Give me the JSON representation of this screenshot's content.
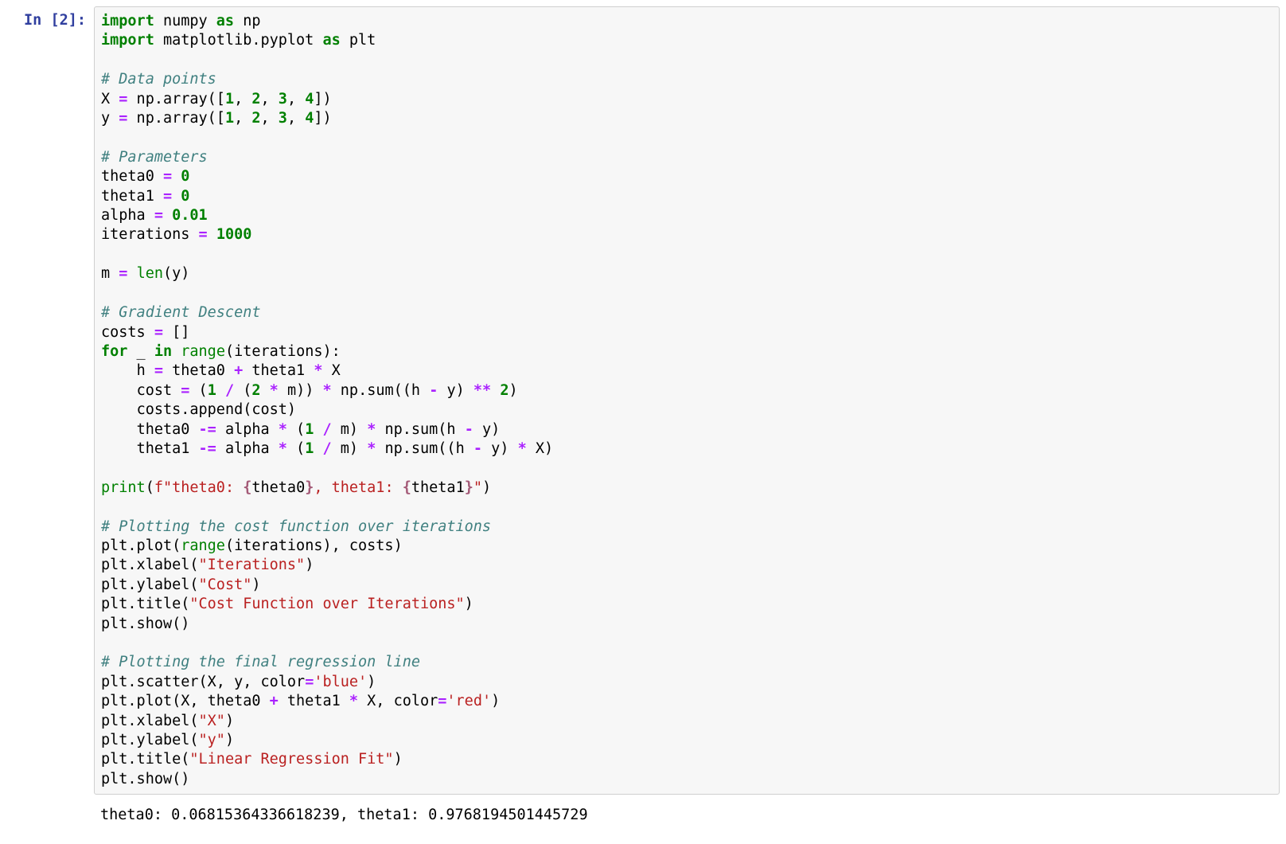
{
  "prompt": "In [2]:",
  "code": {
    "l1": {
      "kw1": "import",
      "sp": " ",
      "n1": "numpy ",
      "kw2": "as",
      "n2": " np"
    },
    "l2": {
      "kw1": "import",
      "n1": " matplotlib.pyplot ",
      "kw2": "as",
      "n2": " plt"
    },
    "l4": {
      "cm": "# Data points"
    },
    "l5": {
      "a": "X ",
      "op1": "=",
      "b": " np.array([",
      "n1": "1",
      "c1": ", ",
      "n2": "2",
      "c2": ", ",
      "n3": "3",
      "c3": ", ",
      "n4": "4",
      "d": "])"
    },
    "l6": {
      "a": "y ",
      "op1": "=",
      "b": " np.array([",
      "n1": "1",
      "c1": ", ",
      "n2": "2",
      "c2": ", ",
      "n3": "3",
      "c3": ", ",
      "n4": "4",
      "d": "])"
    },
    "l8": {
      "cm": "# Parameters"
    },
    "l9": {
      "a": "theta0 ",
      "op": "=",
      "sp": " ",
      "n": "0"
    },
    "l10": {
      "a": "theta1 ",
      "op": "=",
      "sp": " ",
      "n": "0"
    },
    "l11": {
      "a": "alpha ",
      "op": "=",
      "sp": " ",
      "n": "0.01"
    },
    "l12": {
      "a": "iterations ",
      "op": "=",
      "sp": " ",
      "n": "1000"
    },
    "l14": {
      "a": "m ",
      "op": "=",
      "sp": " ",
      "bi": "len",
      "b": "(y)"
    },
    "l16": {
      "cm": "# Gradient Descent"
    },
    "l17": {
      "a": "costs ",
      "op": "=",
      "b": " []"
    },
    "l18": {
      "kw1": "for",
      "a": " _ ",
      "kw2": "in",
      "sp": " ",
      "bi": "range",
      "b": "(iterations):"
    },
    "l19": {
      "ind": "    ",
      "a": "h ",
      "op1": "=",
      "b": " theta0 ",
      "op2": "+",
      "c": " theta1 ",
      "op3": "*",
      "d": " X"
    },
    "l20": {
      "ind": "    ",
      "a": "cost ",
      "op1": "=",
      "b": " (",
      "n1": "1",
      "c": " ",
      "op2": "/",
      "d": " (",
      "n2": "2",
      "e": " ",
      "op3": "*",
      "f": " m)) ",
      "op4": "*",
      "g": " np.sum((h ",
      "op5": "-",
      "h": " y) ",
      "op6": "**",
      "sp": " ",
      "n3": "2",
      "i": ")"
    },
    "l21": {
      "ind": "    ",
      "a": "costs.append(cost)"
    },
    "l22": {
      "ind": "    ",
      "a": "theta0 ",
      "op1": "-=",
      "b": " alpha ",
      "op2": "*",
      "c": " (",
      "n1": "1",
      "d": " ",
      "op3": "/",
      "e": " m) ",
      "op4": "*",
      "f": " np.sum(h ",
      "op5": "-",
      "g": " y)"
    },
    "l23": {
      "ind": "    ",
      "a": "theta1 ",
      "op1": "-=",
      "b": " alpha ",
      "op2": "*",
      "c": " (",
      "n1": "1",
      "d": " ",
      "op3": "/",
      "e": " m) ",
      "op4": "*",
      "f": " np.sum((h ",
      "op5": "-",
      "g": " y) ",
      "op6": "*",
      "h": " X)"
    },
    "l25": {
      "bi": "print",
      "a": "(",
      "s1": "f\"theta0: ",
      "si1": "{",
      "v1": "theta0",
      "si2": "}",
      "s2": ", theta1: ",
      "si3": "{",
      "v2": "theta1",
      "si4": "}",
      "s3": "\"",
      "b": ")"
    },
    "l27": {
      "cm": "# Plotting the cost function over iterations"
    },
    "l28": {
      "a": "plt.plot(",
      "bi": "range",
      "b": "(iterations), costs)"
    },
    "l29": {
      "a": "plt.xlabel(",
      "s": "\"Iterations\"",
      "b": ")"
    },
    "l30": {
      "a": "plt.ylabel(",
      "s": "\"Cost\"",
      "b": ")"
    },
    "l31": {
      "a": "plt.title(",
      "s": "\"Cost Function over Iterations\"",
      "b": ")"
    },
    "l32": {
      "a": "plt.show()"
    },
    "l34": {
      "cm": "# Plotting the final regression line"
    },
    "l35": {
      "a": "plt.scatter(X, y, color",
      "op": "=",
      "s": "'blue'",
      "b": ")"
    },
    "l36": {
      "a": "plt.plot(X, theta0 ",
      "op1": "+",
      "b": " theta1 ",
      "op2": "*",
      "c": " X, color",
      "op3": "=",
      "s": "'red'",
      "d": ")"
    },
    "l37": {
      "a": "plt.xlabel(",
      "s": "\"X\"",
      "b": ")"
    },
    "l38": {
      "a": "plt.ylabel(",
      "s": "\"y\"",
      "b": ")"
    },
    "l39": {
      "a": "plt.title(",
      "s": "\"Linear Regression Fit\"",
      "b": ")"
    },
    "l40": {
      "a": "plt.show()"
    }
  },
  "output": "theta0: 0.06815364336618239, theta1: 0.9768194501445729"
}
